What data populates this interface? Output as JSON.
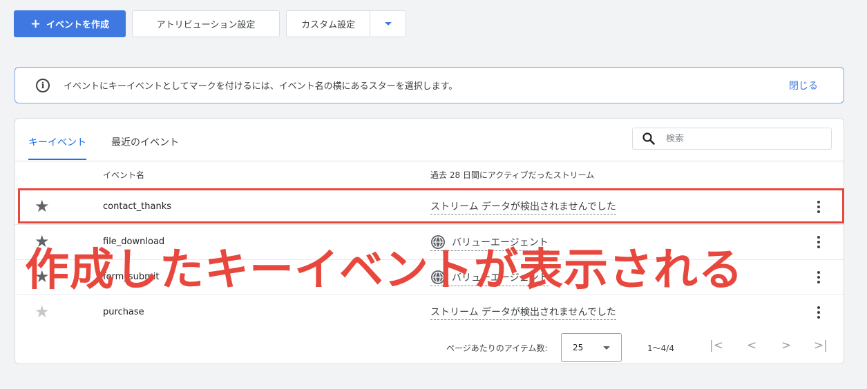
{
  "toolbar": {
    "create_plus": "+",
    "create_label": "イベントを作成",
    "attribution_label": "アトリビューション設定",
    "custom_label": "カスタム設定"
  },
  "banner": {
    "text": "イベントにキーイベントとしてマークを付けるには、イベント名の横にあるスターを選択します。",
    "close": "閉じる"
  },
  "tabs": [
    {
      "label": "キーイベント"
    },
    {
      "label": "最近のイベント"
    }
  ],
  "search": {
    "placeholder": "検索"
  },
  "columns": {
    "event_name": "イベント名",
    "stream": "過去 28 日間にアクティブだったストリーム"
  },
  "rows": [
    {
      "name": "contact_thanks",
      "stream": "ストリーム データが検出されませんでした",
      "starred": true
    },
    {
      "name": "file_download",
      "stream": "バリューエージェント",
      "starred": true
    },
    {
      "name": "form_submit",
      "stream": "バリューエージェント",
      "starred": true
    },
    {
      "name": "purchase",
      "stream": "ストリーム データが検出されませんでした",
      "starred": false
    }
  ],
  "pagination": {
    "per_page_label": "ページあたりのアイテム数:",
    "per_page_value": "25",
    "range": "1〜4/4",
    "first": "|<",
    "prev": "<",
    "next": ">",
    "last": ">|"
  },
  "overlay": {
    "text": "作成したキーイベントが表示される"
  },
  "colors": {
    "accent": "#3f78e0",
    "annotation": "#e8473d"
  }
}
